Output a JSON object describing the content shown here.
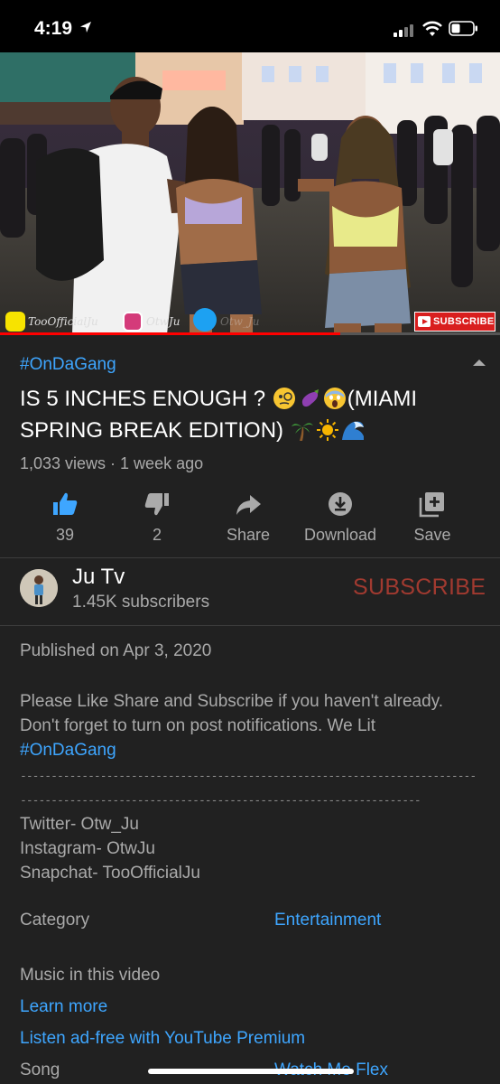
{
  "status_bar": {
    "time": "4:19"
  },
  "video": {
    "watermark": {
      "snapchat": "TooOfficialJu",
      "instagram": "OtwJu",
      "twitter": "Otw_Ju"
    },
    "subscribe_badge": "SUBSCRIBE",
    "progress": 0.68
  },
  "info": {
    "hashtag": "#OnDaGang",
    "title_part1": "IS 5 INCHES ENOUGH ?",
    "title_part2": "(MIAMI SPRING BREAK EDITION)",
    "meta": "1,033 views · 1 week ago"
  },
  "actions": [
    {
      "icon": "thumbs-up-icon",
      "label": "39"
    },
    {
      "icon": "thumbs-down-icon",
      "label": "2"
    },
    {
      "icon": "share-icon",
      "label": "Share"
    },
    {
      "icon": "download-icon",
      "label": "Download"
    },
    {
      "icon": "save-icon",
      "label": "Save"
    }
  ],
  "channel": {
    "name": "Ju Tv",
    "subscribers": "1.45K subscribers",
    "subscribe_label": "SUBSCRIBE"
  },
  "description": {
    "published": "Published on Apr 3, 2020",
    "line1": "Please Like Share and Subscribe if you haven't already.",
    "line2": "Don't forget to turn on post notifications. We Lit",
    "hashtag": "#OnDaGang",
    "dashes": "-------------------------------------------------------------------------------------------------------------------------------------------",
    "twitter": "Twitter- Otw_Ju",
    "instagram": "Instagram- OtwJu",
    "snapchat": "Snapchat- TooOfficialJu"
  },
  "category": {
    "label": "Category",
    "value": "Entertainment"
  },
  "music": {
    "heading": "Music in this video",
    "learn_more": "Learn more",
    "premium": "Listen ad-free with YouTube Premium",
    "song_label": "Song",
    "song_value": "Watch Me Flex"
  },
  "colors": {
    "accent": "#3ea6ff",
    "like_active": "#3ea6ff",
    "subscribe": "#a13a30",
    "background": "#212121"
  }
}
